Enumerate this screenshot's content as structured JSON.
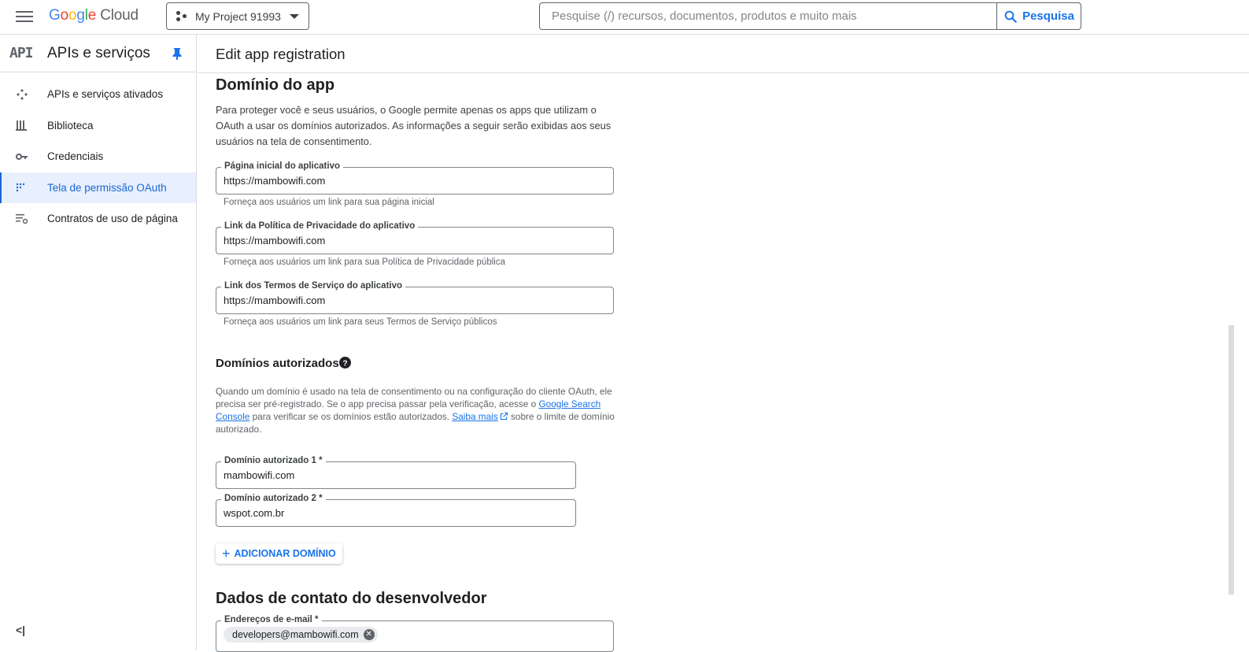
{
  "topbar": {
    "logo_google": "Google",
    "logo_cloud": "Cloud",
    "project_name": "My Project 91993",
    "search_placeholder": "Pesquise (/) recursos, documentos, produtos e muito mais",
    "search_button": "Pesquisa"
  },
  "sidebar": {
    "logo": "API",
    "title": "APIs e serviços",
    "items": [
      {
        "label": "APIs e serviços ativados",
        "icon": "apis-icon"
      },
      {
        "label": "Biblioteca",
        "icon": "library-icon"
      },
      {
        "label": "Credenciais",
        "icon": "key-icon"
      },
      {
        "label": "Tela de permissão OAuth",
        "icon": "oauth-consent-icon",
        "active": true
      },
      {
        "label": "Contratos de uso de página",
        "icon": "page-contracts-icon"
      }
    ],
    "collapse": "<|"
  },
  "main": {
    "title": "Edit app registration",
    "app_domain": {
      "heading": "Domínio do app",
      "description": "Para proteger você e seus usuários, o Google permite apenas os apps que utilizam o OAuth a usar os domínios autorizados. As informações a seguir serão exibidas aos seus usuários na tela de consentimento.",
      "fields": [
        {
          "label": "Página inicial do aplicativo",
          "value": "https://mambowifi.com",
          "hint": "Forneça aos usuários um link para sua página inicial"
        },
        {
          "label": "Link da Política de Privacidade do aplicativo",
          "value": "https://mambowifi.com",
          "hint": "Forneça aos usuários um link para sua Política de Privacidade pública"
        },
        {
          "label": "Link dos Termos de Serviço do aplicativo",
          "value": "https://mambowifi.com",
          "hint": "Forneça aos usuários um link para seus Termos de Serviço públicos"
        }
      ]
    },
    "authorized_domains": {
      "heading": "Domínios autorizados",
      "text_1": "Quando um domínio é usado na tela de consentimento ou na configuração do cliente OAuth, ele precisa ser pré-registrado. Se o app precisa passar pela verificação, acesse o ",
      "link_search_console": "Google Search Console",
      "text_2": " para verificar se os domínios estão autorizados. ",
      "link_learn_more": "Saiba mais",
      "text_3": " sobre o limite de domínio autorizado.",
      "domains": [
        {
          "label": "Domínio autorizado 1 *",
          "value": "mambowifi.com"
        },
        {
          "label": "Domínio autorizado 2 *",
          "value": "wspot.com.br"
        }
      ],
      "add_button": "ADICIONAR DOMÍNIO"
    },
    "developer_contact": {
      "heading": "Dados de contato do desenvolvedor",
      "email_label": "Endereços de e-mail *",
      "email_chip": "developers@mambowifi.com"
    }
  },
  "colors": {
    "accent": "#1a73e8",
    "active_bg": "#e8f0fe",
    "border": "#dadce0"
  }
}
